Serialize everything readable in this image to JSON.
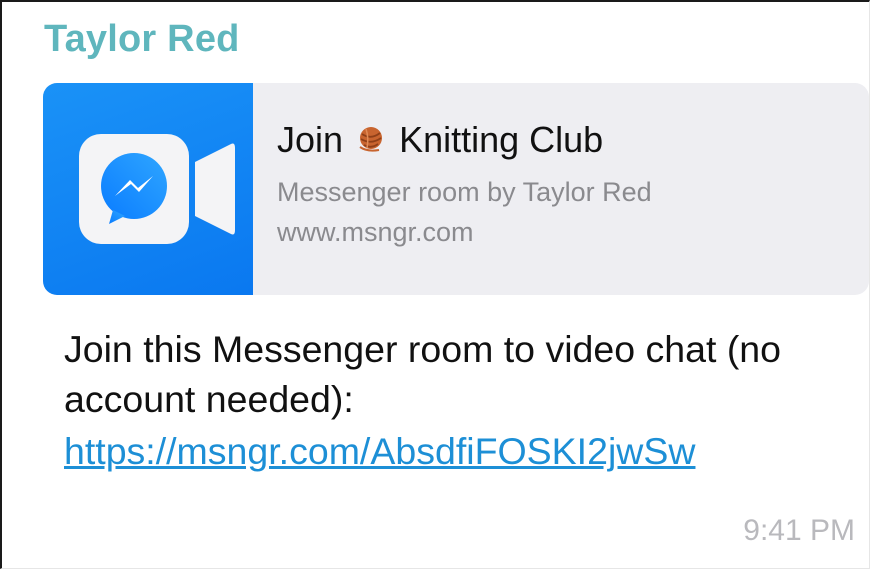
{
  "message": {
    "sender": "Taylor Red",
    "link_preview": {
      "title_prefix": "Join",
      "title_emoji": "yarn",
      "title_suffix": "Knitting Club",
      "subtitle": "Messenger room by Taylor Red",
      "domain": "www.msngr.com",
      "thumbnail_icon": "messenger-video-icon"
    },
    "body": "Join this Messenger room to video chat (no account needed):",
    "link": "https://msngr.com/AbsdfiFOSKI2jwSw",
    "timestamp": "9:41 PM"
  },
  "colors": {
    "sender": "#5fb6bd",
    "link": "#1d8fd6",
    "thumbnail_bg": "#0a78f0",
    "card_bg": "#eeeef2",
    "muted_text": "#8a8a8e",
    "timestamp": "#b9b9bd"
  }
}
